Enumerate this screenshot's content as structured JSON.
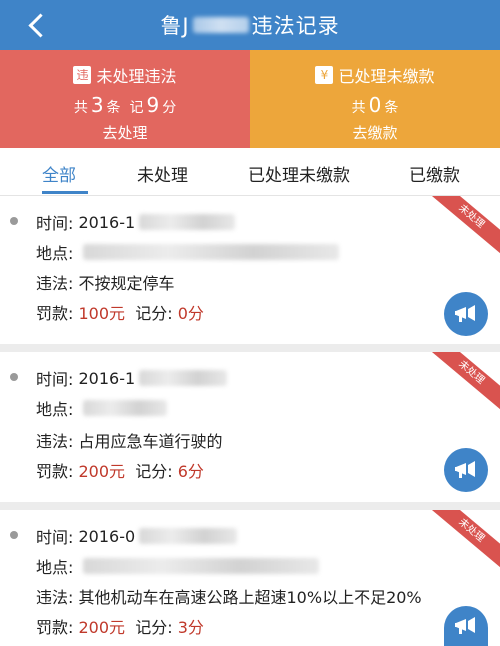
{
  "header": {
    "title_prefix": "鲁J",
    "title_suffix": "违法记录"
  },
  "summary": {
    "unprocessed": {
      "icon_char": "违",
      "label": "未处理违法",
      "total_prefix": "共",
      "count": "3",
      "count_unit": "条",
      "points_prefix": "记",
      "points": "9",
      "points_unit": "分",
      "action": "去处理"
    },
    "unpaid": {
      "icon_char": "¥",
      "label": "已处理未缴款",
      "total_prefix": "共",
      "count": "0",
      "count_unit": "条",
      "action": "去缴款"
    }
  },
  "tabs": [
    "全部",
    "未处理",
    "已处理未缴款",
    "已缴款"
  ],
  "labels": {
    "time": "时间:",
    "place": "地点:",
    "violation": "违法:",
    "fine": "罚款:",
    "points": "记分:"
  },
  "records": [
    {
      "time": "2016-1",
      "place": "",
      "violation": "不按规定停车",
      "fine": "100元",
      "points": "0分",
      "status": "未处理"
    },
    {
      "time": "2016-1",
      "place": "",
      "violation": "占用应急车道行驶的",
      "fine": "200元",
      "points": "6分",
      "status": "未处理"
    },
    {
      "time": "2016-0",
      "place": "",
      "violation": "其他机动车在高速公路上超速10%以上不足20%",
      "fine": "200元",
      "points": "3分",
      "status": "未处理"
    }
  ],
  "colors": {
    "header": "#3f84c8",
    "unprocessed_panel": "#e2675f",
    "unpaid_panel": "#eda63b",
    "fine_text": "#c0392b",
    "ribbon": "#d9534f"
  }
}
